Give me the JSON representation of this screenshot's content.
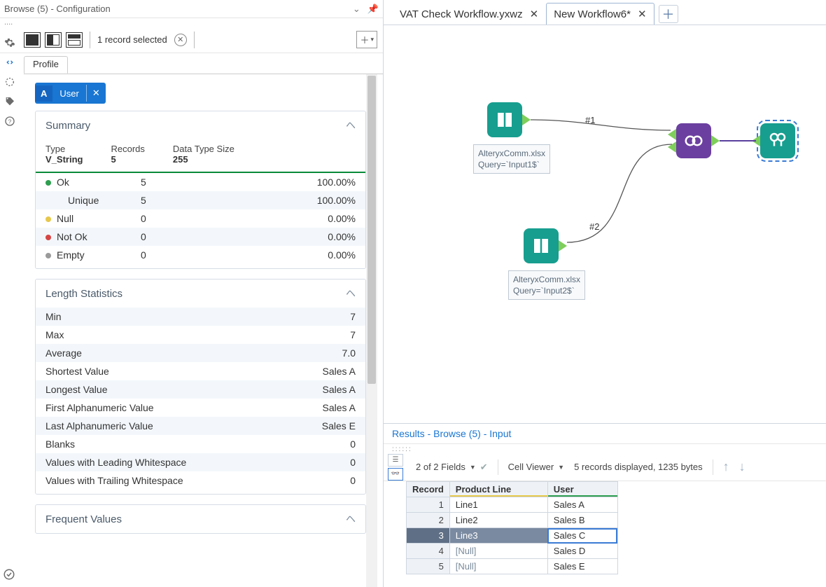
{
  "config": {
    "title": "Browse (5) - Configuration",
    "records_selected": "1 record selected",
    "profile_tab": "Profile",
    "field_prefix": "A",
    "field_name": "User",
    "summary": {
      "heading": "Summary",
      "type_label": "Type",
      "type_value": "V_String",
      "records_label": "Records",
      "records_value": "5",
      "size_label": "Data Type Size",
      "size_value": "255",
      "rows": [
        {
          "name": "Ok",
          "count": "5",
          "pct": "100.00%",
          "dot": "green"
        },
        {
          "name": "Unique",
          "count": "5",
          "pct": "100.00%",
          "dot": ""
        },
        {
          "name": "Null",
          "count": "0",
          "pct": "0.00%",
          "dot": "yellow"
        },
        {
          "name": "Not Ok",
          "count": "0",
          "pct": "0.00%",
          "dot": "red"
        },
        {
          "name": "Empty",
          "count": "0",
          "pct": "0.00%",
          "dot": "gray"
        }
      ]
    },
    "length": {
      "heading": "Length Statistics",
      "rows": [
        {
          "k": "Min",
          "v": "7"
        },
        {
          "k": "Max",
          "v": "7"
        },
        {
          "k": "Average",
          "v": "7.0"
        },
        {
          "k": "Shortest Value",
          "v": "Sales A"
        },
        {
          "k": "Longest Value",
          "v": "Sales A"
        },
        {
          "k": "First Alphanumeric Value",
          "v": "Sales A"
        },
        {
          "k": "Last Alphanumeric Value",
          "v": "Sales E"
        },
        {
          "k": "Blanks",
          "v": "0"
        },
        {
          "k": "Values with Leading Whitespace",
          "v": "0"
        },
        {
          "k": "Values with Trailing Whitespace",
          "v": "0"
        }
      ]
    },
    "frequent_heading": "Frequent Values"
  },
  "tabs": {
    "t1": "VAT Check Workflow.yxwz",
    "t2": "New Workflow6*"
  },
  "canvas": {
    "input1_label": "AlteryxComm.xlsx\nQuery=`Input1$`",
    "input2_label": "AlteryxComm.xlsx\nQuery=`Input2$`",
    "conn1": "#1",
    "conn2": "#2"
  },
  "results": {
    "title": "Results - Browse (5) - Input",
    "fields_text": "2 of 2 Fields",
    "cell_viewer": "Cell Viewer",
    "records_text": "5 records displayed, 1235 bytes",
    "headers": {
      "rec": "Record",
      "c1": "Product Line",
      "c2": "User"
    },
    "rows": [
      {
        "n": "1",
        "pl": "Line1",
        "u": "Sales A"
      },
      {
        "n": "2",
        "pl": "Line2",
        "u": "Sales B"
      },
      {
        "n": "3",
        "pl": "Line3",
        "u": "Sales C"
      },
      {
        "n": "4",
        "pl": "[Null]",
        "u": "Sales D"
      },
      {
        "n": "5",
        "pl": "[Null]",
        "u": "Sales E"
      }
    ]
  }
}
